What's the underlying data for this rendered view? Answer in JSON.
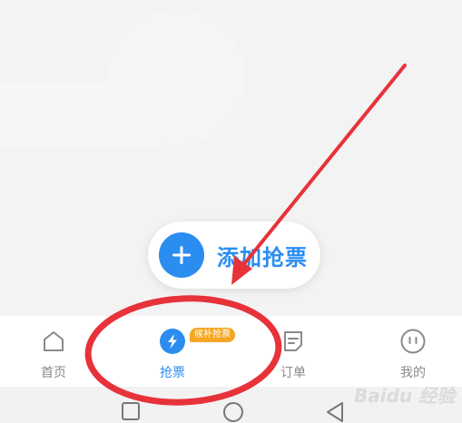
{
  "fab": {
    "label": "添加抢票",
    "icon": "plus-icon"
  },
  "tabs": [
    {
      "id": "home",
      "label": "首页",
      "icon": "home-icon",
      "active": false
    },
    {
      "id": "grab",
      "label": "抢票",
      "icon": "lightning-icon",
      "active": true,
      "badge": "候补抢票"
    },
    {
      "id": "orders",
      "label": "订单",
      "icon": "order-icon",
      "active": false
    },
    {
      "id": "mine",
      "label": "我的",
      "icon": "profile-face-icon",
      "active": false
    }
  ],
  "system_nav": [
    "square-recents-icon",
    "circle-home-icon",
    "triangle-back-icon"
  ],
  "colors": {
    "accent": "#2b8df0",
    "badge": "#f5a623",
    "annotation": "#e8323a",
    "inactive": "#8a8a8a"
  },
  "watermark": "Baidu 经验"
}
